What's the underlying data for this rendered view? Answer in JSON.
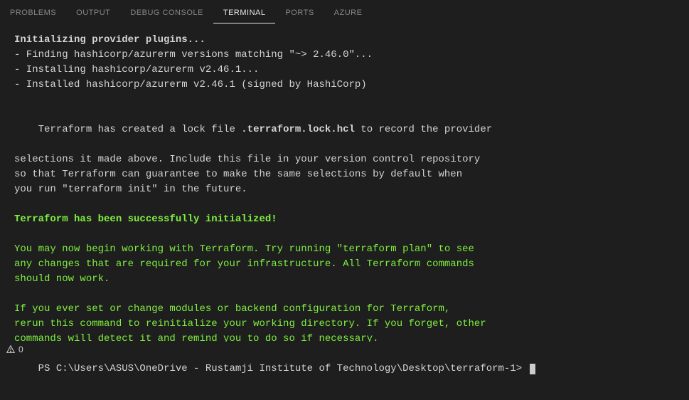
{
  "tabs": {
    "problems": "PROBLEMS",
    "output": "OUTPUT",
    "debug_console": "DEBUG CONSOLE",
    "terminal": "TERMINAL",
    "ports": "PORTS",
    "azure": "AZURE"
  },
  "terminal": {
    "init_header": "Initializing provider plugins...",
    "finding": "- Finding hashicorp/azurerm versions matching \"~> 2.46.0\"...",
    "installing": "- Installing hashicorp/azurerm v2.46.1...",
    "installed": "- Installed hashicorp/azurerm v2.46.1 (signed by HashiCorp)",
    "lock_pre": "Terraform has created a lock file ",
    "lock_file": ".terraform.lock.hcl",
    "lock_post": " to record the provider",
    "lock_l2": "selections it made above. Include this file in your version control repository",
    "lock_l3": "so that Terraform can guarantee to make the same selections by default when",
    "lock_l4": "you run \"terraform init\" in the future.",
    "success": "Terraform has been successfully initialized!",
    "hint1_l1": "You may now begin working with Terraform. Try running \"terraform plan\" to see",
    "hint1_l2": "any changes that are required for your infrastructure. All Terraform commands",
    "hint1_l3": "should now work.",
    "hint2_l1": "If you ever set or change modules or backend configuration for Terraform,",
    "hint2_l2": "rerun this command to reinitialize your working directory. If you forget, other",
    "hint2_l3": "commands will detect it and remind you to do so if necessary.",
    "prompt": "PS C:\\Users\\ASUS\\OneDrive - Rustamji Institute of Technology\\Desktop\\terraform-1> "
  },
  "status": {
    "count": "0"
  }
}
